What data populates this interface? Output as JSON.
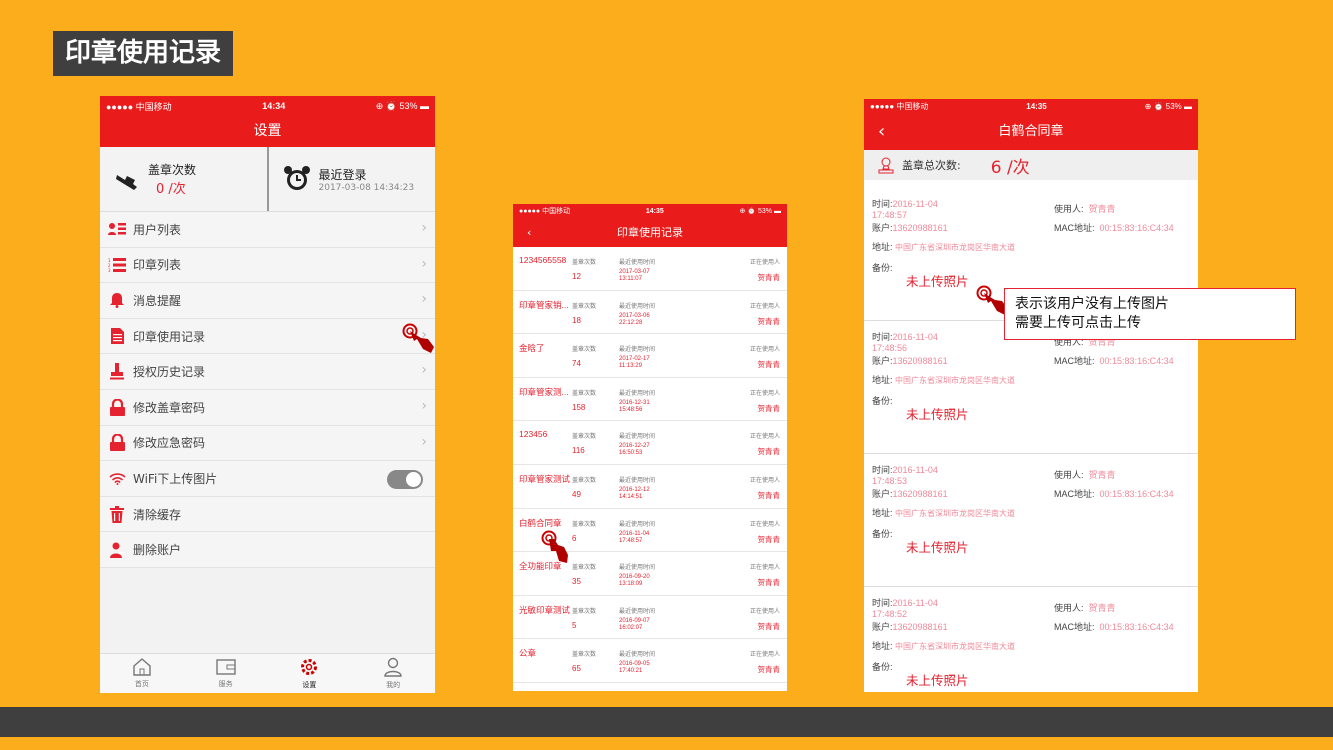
{
  "slide": {
    "title": "印章使用记录"
  },
  "settings_phone": {
    "status": {
      "carrier": "●●●●● 中国移动",
      "time": "14:34",
      "battery": "53%"
    },
    "title": "设置",
    "stamp_count": {
      "label": "盖章次数",
      "value": "0 /次"
    },
    "last_login": {
      "label": "最近登录",
      "value": "2017-03-08 14:34:23"
    },
    "menu": [
      {
        "label": "用户列表",
        "icon": "user-list-icon"
      },
      {
        "label": "印章列表",
        "icon": "numbered-list-icon"
      },
      {
        "label": "消息提醒",
        "icon": "bell-icon"
      },
      {
        "label": "印章使用记录",
        "icon": "document-icon"
      },
      {
        "label": "授权历史记录",
        "icon": "stamp-icon"
      },
      {
        "label": "修改盖章密码",
        "icon": "lock-icon"
      },
      {
        "label": "修改应急密码",
        "icon": "lock-icon"
      },
      {
        "label": "WiFi下上传图片",
        "icon": "wifi-icon"
      },
      {
        "label": "清除缓存",
        "icon": "trash-icon"
      },
      {
        "label": "删除账户",
        "icon": "user-delete-icon"
      }
    ],
    "tabs": [
      "首页",
      "服务",
      "设置",
      "我的"
    ]
  },
  "records_phone": {
    "status": {
      "carrier": "●●●●● 中国移动",
      "time": "14:35",
      "battery": "53%"
    },
    "title": "印章使用记录",
    "count_label": "盖章次数",
    "time_label": "最近使用时间",
    "user_label": "正在使用人",
    "records": [
      {
        "name": "1234565558",
        "count": "12",
        "date": "2017-03-07",
        "time": "13:11:07",
        "user": "贺青青"
      },
      {
        "name": "印章管家销...",
        "count": "18",
        "date": "2017-03-06",
        "time": "22:12:28",
        "user": "贺青青"
      },
      {
        "name": "金晗了",
        "count": "74",
        "date": "2017-02-17",
        "time": "11:13:29",
        "user": "贺青青"
      },
      {
        "name": "印章管家测...",
        "count": "158",
        "date": "2016-12-31",
        "time": "15:48:56",
        "user": "贺青青"
      },
      {
        "name": "123456",
        "count": "116",
        "date": "2016-12-27",
        "time": "16:50:53",
        "user": "贺青青"
      },
      {
        "name": "印章管家测试",
        "count": "49",
        "date": "2016-12-12",
        "time": "14:14:51",
        "user": "贺青青"
      },
      {
        "name": "白鹤合同章",
        "count": "6",
        "date": "2016-11-04",
        "time": "17:48:57",
        "user": "贺青青"
      },
      {
        "name": "全功能印章",
        "count": "35",
        "date": "2016-09-20",
        "time": "13:18:09",
        "user": "贺青青"
      },
      {
        "name": "光敏印章测试",
        "count": "5",
        "date": "2016-09-07",
        "time": "16:02:07",
        "user": "贺青青"
      },
      {
        "name": "公章",
        "count": "65",
        "date": "2016-09-05",
        "time": "17:40:21",
        "user": "贺青青"
      }
    ]
  },
  "detail_phone": {
    "status": {
      "carrier": "●●●●● 中国移动",
      "time": "14:35",
      "battery": "53%"
    },
    "title": "白鹤合同章",
    "back": "‹",
    "total_label": "盖章总次数:",
    "total_value": "6 /次",
    "labels": {
      "time": "时间:",
      "account": "账户:",
      "user": "使用人:",
      "mac": "MAC地址:",
      "address": "地址:",
      "note": "备份:"
    },
    "entries": [
      {
        "date": "2016-11-04",
        "time": "17:48:57",
        "account": "13620988161",
        "user": "贺青青",
        "mac": "00:15:83:16:C4:34",
        "address": "中国广东省深圳市龙岗区华南大道",
        "photo": "未上传照片"
      },
      {
        "date": "2016-11-04",
        "time": "17:48:56",
        "account": "13620988161",
        "user": "贺青青",
        "mac": "00:15:83:16:C4:34",
        "address": "中国广东省深圳市龙岗区华南大道",
        "photo": "未上传照片"
      },
      {
        "date": "2016-11-04",
        "time": "17:48:53",
        "account": "13620988161",
        "user": "贺青青",
        "mac": "00:15:83:16:C4:34",
        "address": "中国广东省深圳市龙岗区华南大道",
        "photo": "未上传照片"
      },
      {
        "date": "2016-11-04",
        "time": "17:48:52",
        "account": "13620988161",
        "user": "贺青青",
        "mac": "00:15:83:16:C4:34",
        "address": "中国广东省深圳市龙岗区华南大道",
        "photo": "未上传照片"
      }
    ]
  },
  "callout": {
    "line1": "表示该用户没有上传图片",
    "line2": "需要上传可点击上传"
  },
  "colors": {
    "background": "#fbad1c",
    "accent": "#ea1b1b",
    "dark": "#3f3f3f"
  }
}
